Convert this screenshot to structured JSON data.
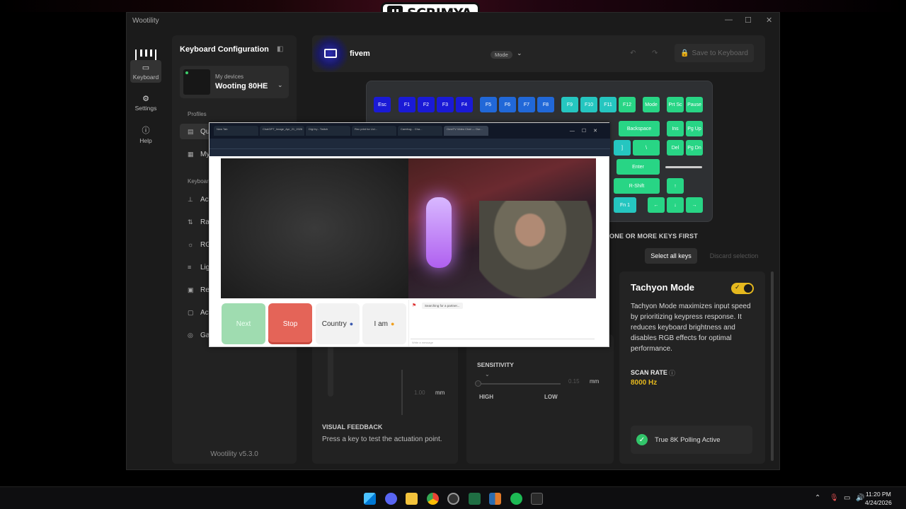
{
  "overlay": {
    "channel": "SCRIMYA"
  },
  "window": {
    "title": "Wootility"
  },
  "rail": {
    "items": [
      {
        "label": "Keyboard",
        "icon": "keyboard-icon"
      },
      {
        "label": "Settings",
        "icon": "gear-icon"
      },
      {
        "label": "Help",
        "icon": "help-icon"
      }
    ]
  },
  "config": {
    "title": "Keyboard Configuration",
    "device_label": "My devices",
    "device_name": "Wooting 80HE",
    "profiles_label": "Profiles",
    "profiles": [
      "Qu",
      "My"
    ],
    "keyboard_label": "Keyboar",
    "keyboard_items": [
      "Ac",
      "Ra",
      "RG",
      "Lig",
      "Re",
      "Ac",
      "Ga"
    ],
    "version": "Wootility v5.3.0"
  },
  "topbar": {
    "profile_name": "fivem",
    "mode_label": "Mode",
    "save_label": "Save to Keyboard"
  },
  "keys": {
    "row0": [
      "Esc",
      "F1",
      "F2",
      "F3",
      "F4",
      "F5",
      "F6",
      "F7",
      "F8",
      "F9",
      "F10",
      "F11",
      "F12",
      "Mode",
      "Prt Sc",
      "Pause"
    ],
    "backspace": "Backspace",
    "ins": "Ins",
    "pgup": "Pg Up",
    "bracket": "]",
    "backslash": "\\",
    "del": "Del",
    "pgdn": "Pg Dn",
    "enter": "Enter",
    "rshift": "R-Shift",
    "up": "↑",
    "fn": "Fn 1",
    "left": "←",
    "down": "↓",
    "right": "→"
  },
  "selection": {
    "hint": "ONE OR MORE KEYS FIRST",
    "select_all": "Select all keys",
    "discard": "Discard selection"
  },
  "actuation": {
    "value": "1.00",
    "unit": "mm",
    "visual_feedback_title": "VISUAL FEEDBACK",
    "visual_feedback_text": "Press a key to test the actuation point."
  },
  "sensitivity": {
    "title": "SENSITIVITY",
    "value": "0.15",
    "unit": "mm",
    "high": "HIGH",
    "low": "LOW"
  },
  "tachyon": {
    "title": "Tachyon Mode",
    "enabled": true,
    "description": "Tachyon Mode maximizes input speed by prioritizing keypress response. It reduces keyboard brightness and disables RGB effects for optimal performance.",
    "scan_rate_label": "SCAN RATE",
    "scan_rate_value": "8000 Hz",
    "polling_text": "True 8K Polling Active"
  },
  "popup": {
    "tabs": [
      "New Tab",
      "ChatGPT_Image_Apr_21_2026",
      "Digi try - Twitch",
      "Rec print for Ucl...",
      "Camfrog... Cha...",
      "OmeTV Video Chat — Our..."
    ],
    "buttons": {
      "next": "Next",
      "stop": "Stop",
      "country": "Country",
      "iam": "I am"
    },
    "chat_status": "Searching for a partner...",
    "chat_placeholder": "Write a message"
  },
  "taskbar": {
    "time": "11:20 PM",
    "date": "4/24/2026"
  },
  "colors": {
    "accent_yellow": "#e5b81e",
    "key_blue": "#1a1ad6",
    "key_green": "#28d585",
    "key_teal": "#25c6c0"
  }
}
